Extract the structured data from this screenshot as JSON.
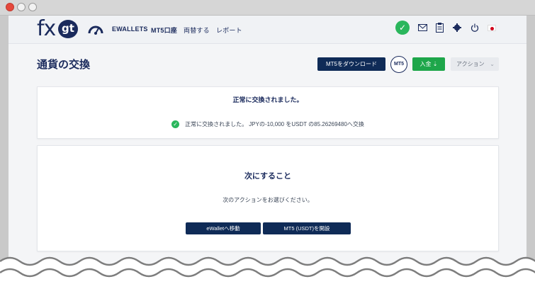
{
  "nav": {
    "logo_main": "fx",
    "logo_badge": "gt",
    "links": [
      "EWALLETS",
      "MT5口座",
      "両替する",
      "レポート"
    ]
  },
  "page": {
    "title": "通貨の交換",
    "download_label": "MT5をダウンロード",
    "mt5_badge": "MT5",
    "deposit_label": "入金 ⇣",
    "action_label": "アクション"
  },
  "result": {
    "title": "正常に交換されました。",
    "message": "正常に交換されました。 JPYの-10,000 をUSDT の85.26269480へ交換"
  },
  "next": {
    "title": "次にすること",
    "prompt": "次のアクションをお選びください。",
    "btn_wallet": "eWalletへ移動",
    "btn_mt5": "MT5 (USDT)を開設"
  },
  "colors": {
    "brand": "#1a2a5c",
    "primary_button": "#0f2b57",
    "success": "#2ab65c"
  }
}
